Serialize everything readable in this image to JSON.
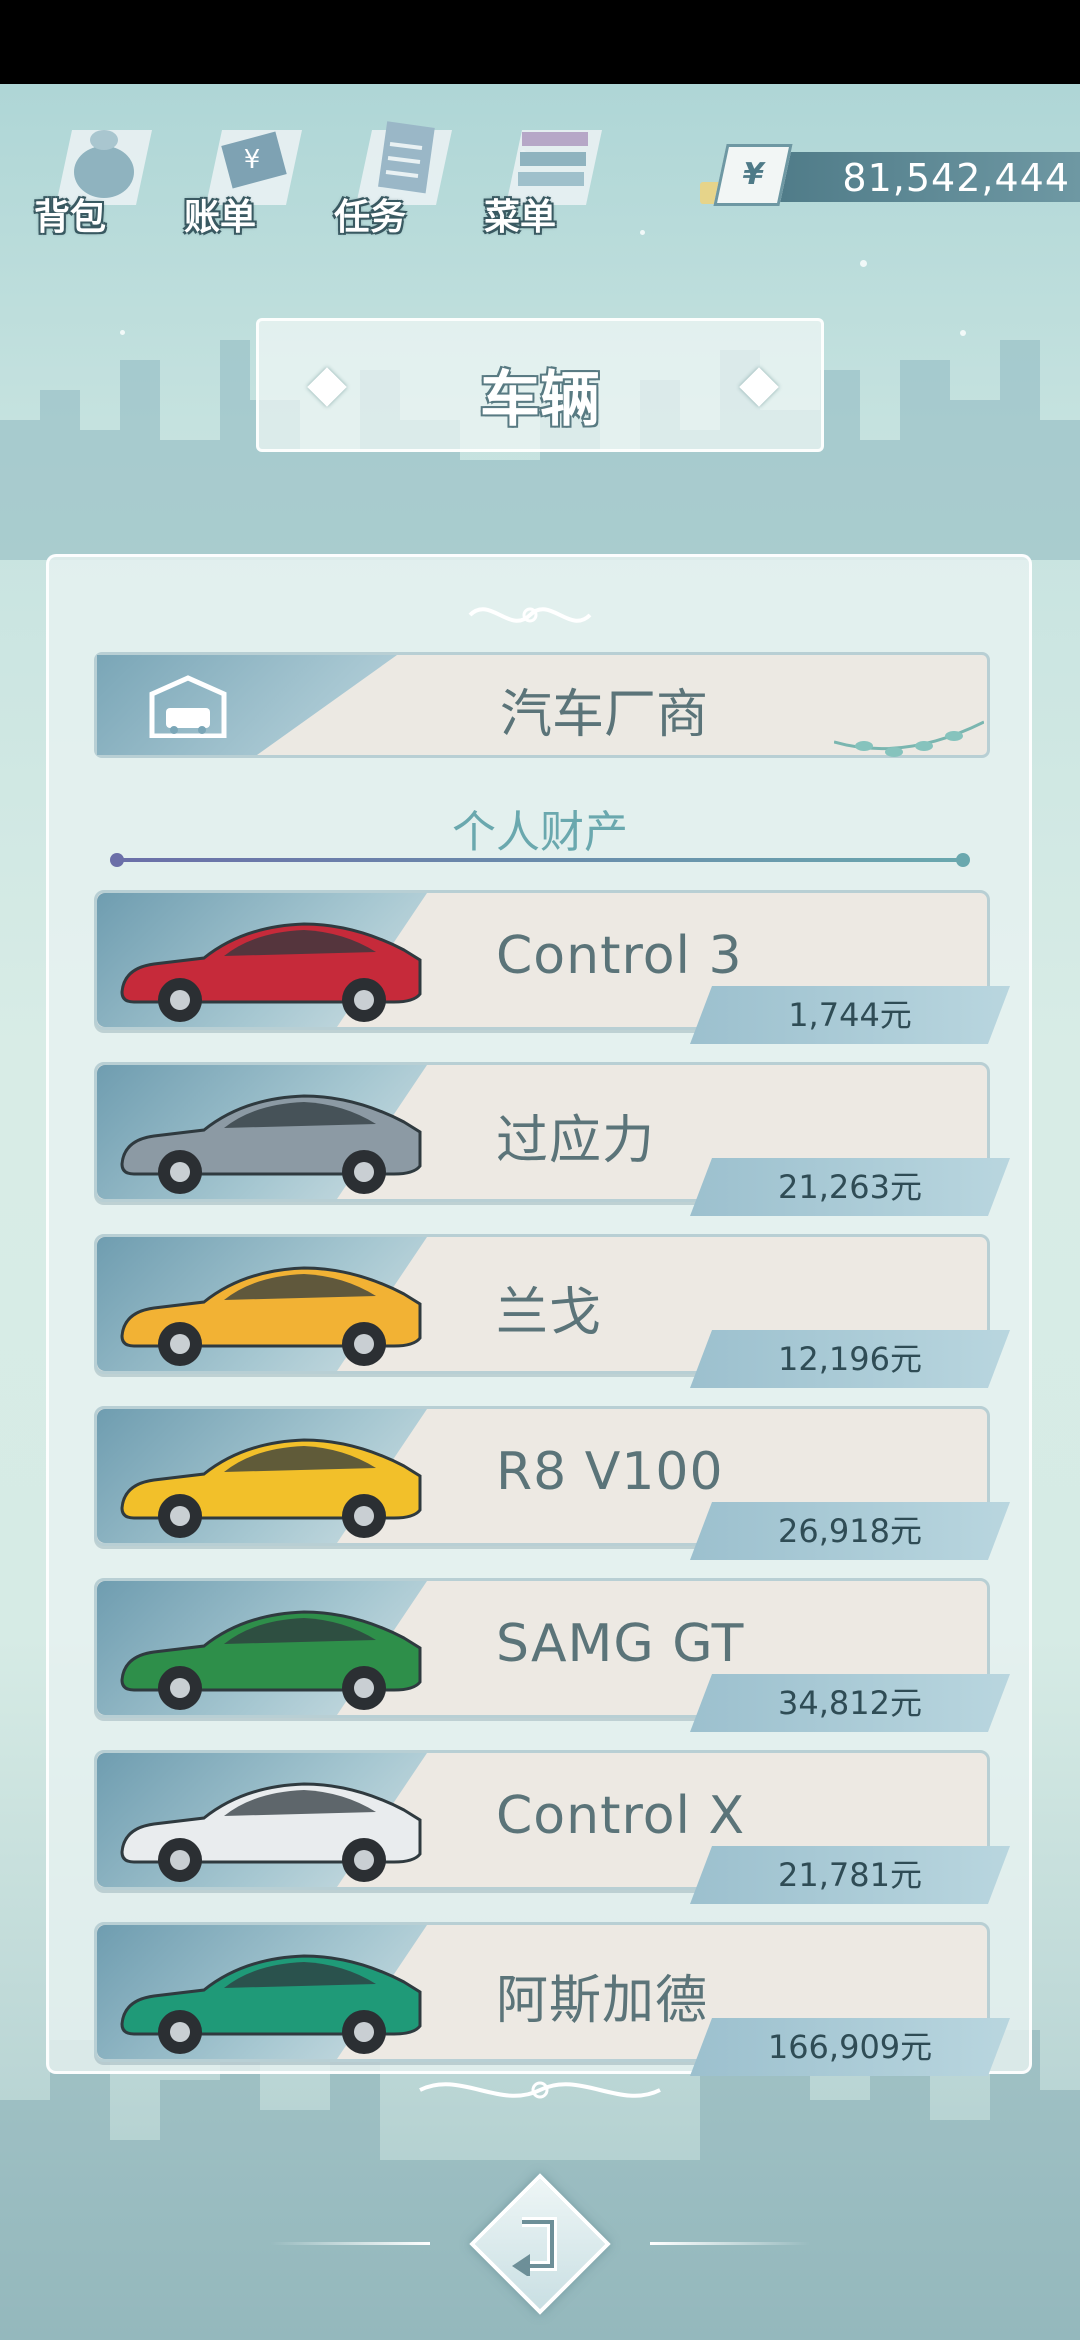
{
  "top_bar": {
    "buttons": [
      {
        "label": "背包",
        "icon": "backpack-icon"
      },
      {
        "label": "账单",
        "icon": "bill-icon"
      },
      {
        "label": "任务",
        "icon": "task-icon"
      },
      {
        "label": "菜单",
        "icon": "menu-icon"
      }
    ],
    "currency_symbol": "¥",
    "money": "81,542,444"
  },
  "title": "车辆",
  "maker_button": {
    "label": "汽车厂商",
    "icon": "garage-icon"
  },
  "section_title": "个人财产",
  "cars": [
    {
      "name": "Control 3",
      "price": "1,744元",
      "color": "#c62a3a"
    },
    {
      "name": "过应力",
      "price": "21,263元",
      "color": "#8c9aa4"
    },
    {
      "name": "兰戈",
      "price": "12,196元",
      "color": "#f2b234"
    },
    {
      "name": "R8 V100",
      "price": "26,918元",
      "color": "#f2c02a"
    },
    {
      "name": "SAMG GT",
      "price": "34,812元",
      "color": "#2e8f4a"
    },
    {
      "name": "Control X",
      "price": "21,781元",
      "color": "#e9ecee"
    },
    {
      "name": "阿斯加德",
      "price": "166,909元",
      "color": "#1f9a78"
    }
  ],
  "back_button": {
    "icon": "back-arrow-icon"
  }
}
